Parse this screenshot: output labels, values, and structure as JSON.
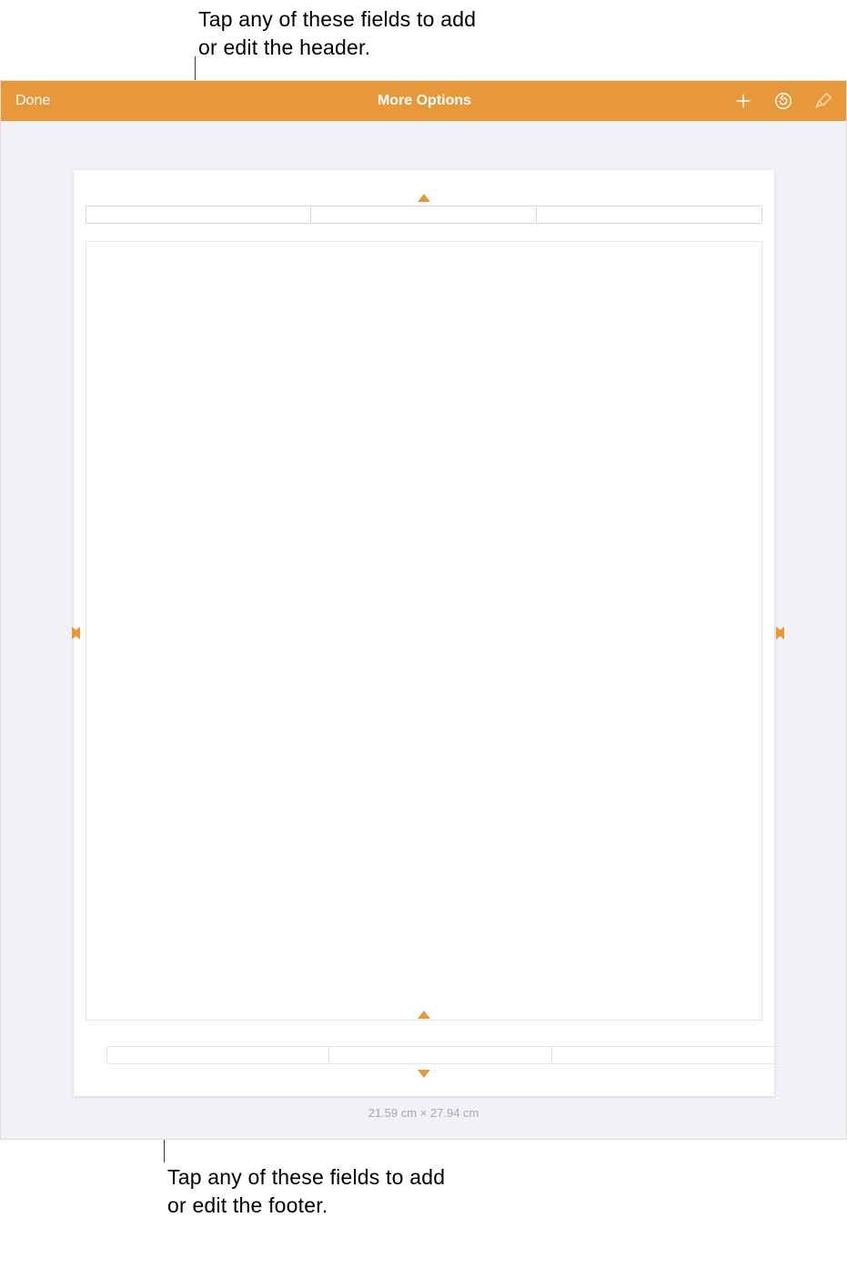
{
  "callouts": {
    "header": "Tap any of these fields to add or edit the header.",
    "footer": "Tap any of these fields to add or edit the footer."
  },
  "toolbar": {
    "done_label": "Done",
    "title": "More Options",
    "icons": {
      "add": "add-icon",
      "undo": "undo-icon",
      "format_brush": "format-brush-icon"
    }
  },
  "page": {
    "dimensions_label": "21.59 cm × 27.94 cm",
    "header_fields": [
      "",
      "",
      ""
    ],
    "footer_fields": [
      "",
      "",
      ""
    ]
  }
}
